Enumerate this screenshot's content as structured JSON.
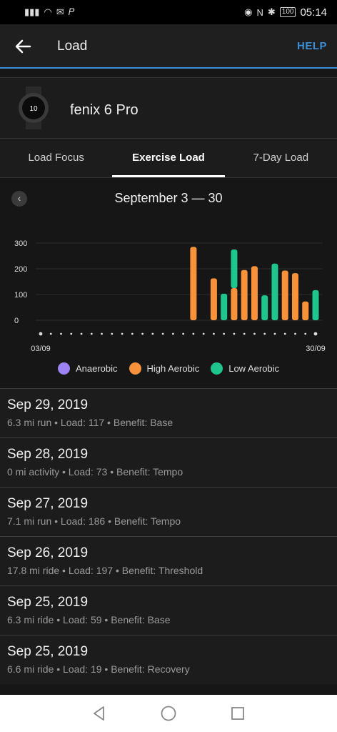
{
  "status_bar": {
    "time": "05:14",
    "battery": "100"
  },
  "header": {
    "title": "Load",
    "help_label": "HELP"
  },
  "device": {
    "name": "fenix 6 Pro",
    "watch_face_text": "10"
  },
  "tabs": [
    {
      "label": "Load Focus",
      "active": false
    },
    {
      "label": "Exercise Load",
      "active": true
    },
    {
      "label": "7-Day Load",
      "active": false
    }
  ],
  "chart_header": {
    "date_range": "September 3 — 30"
  },
  "chart_data": {
    "type": "bar",
    "x_start_label": "03/09",
    "x_end_label": "30/09",
    "y_ticks": [
      "300",
      "200",
      "100",
      "0"
    ],
    "ylim": [
      0,
      300
    ],
    "days": 28,
    "series": [
      {
        "name": "High Aerobic",
        "color": "#f7923a",
        "points": [
          {
            "day": 16,
            "value": 285
          },
          {
            "day": 18,
            "value": 163
          },
          {
            "day": 20,
            "value": 125
          },
          {
            "day": 21,
            "value": 195
          },
          {
            "day": 22,
            "value": 210
          },
          {
            "day": 25,
            "value": 193
          },
          {
            "day": 26,
            "value": 183
          },
          {
            "day": 27,
            "value": 73
          }
        ]
      },
      {
        "name": "Low Aerobic",
        "color": "#1ec68e",
        "points": [
          {
            "day": 19,
            "value": 103
          },
          {
            "day": 20,
            "value": 150
          },
          {
            "day": 23,
            "value": 97
          },
          {
            "day": 24,
            "value": 220
          },
          {
            "day": 28,
            "value": 117
          }
        ]
      }
    ],
    "legend": [
      {
        "label": "Anaerobic",
        "color": "#9d83f2"
      },
      {
        "label": "High Aerobic",
        "color": "#f7923a"
      },
      {
        "label": "Low Aerobic",
        "color": "#1ec68e"
      }
    ]
  },
  "activities": [
    {
      "date": "Sep 29, 2019",
      "detail": "6.3 mi run • Load: 117 • Benefit: Base"
    },
    {
      "date": "Sep 28, 2019",
      "detail": "0 mi activity • Load: 73 • Benefit: Tempo"
    },
    {
      "date": "Sep 27, 2019",
      "detail": "7.1 mi run • Load: 186 • Benefit: Tempo"
    },
    {
      "date": "Sep 26, 2019",
      "detail": "17.8 mi ride • Load: 197 • Benefit: Threshold"
    },
    {
      "date": "Sep 25, 2019",
      "detail": "6.3 mi ride • Load: 59 • Benefit: Base"
    },
    {
      "date": "Sep 25, 2019",
      "detail": "6.6 mi ride • Load: 19 • Benefit: Recovery"
    }
  ]
}
